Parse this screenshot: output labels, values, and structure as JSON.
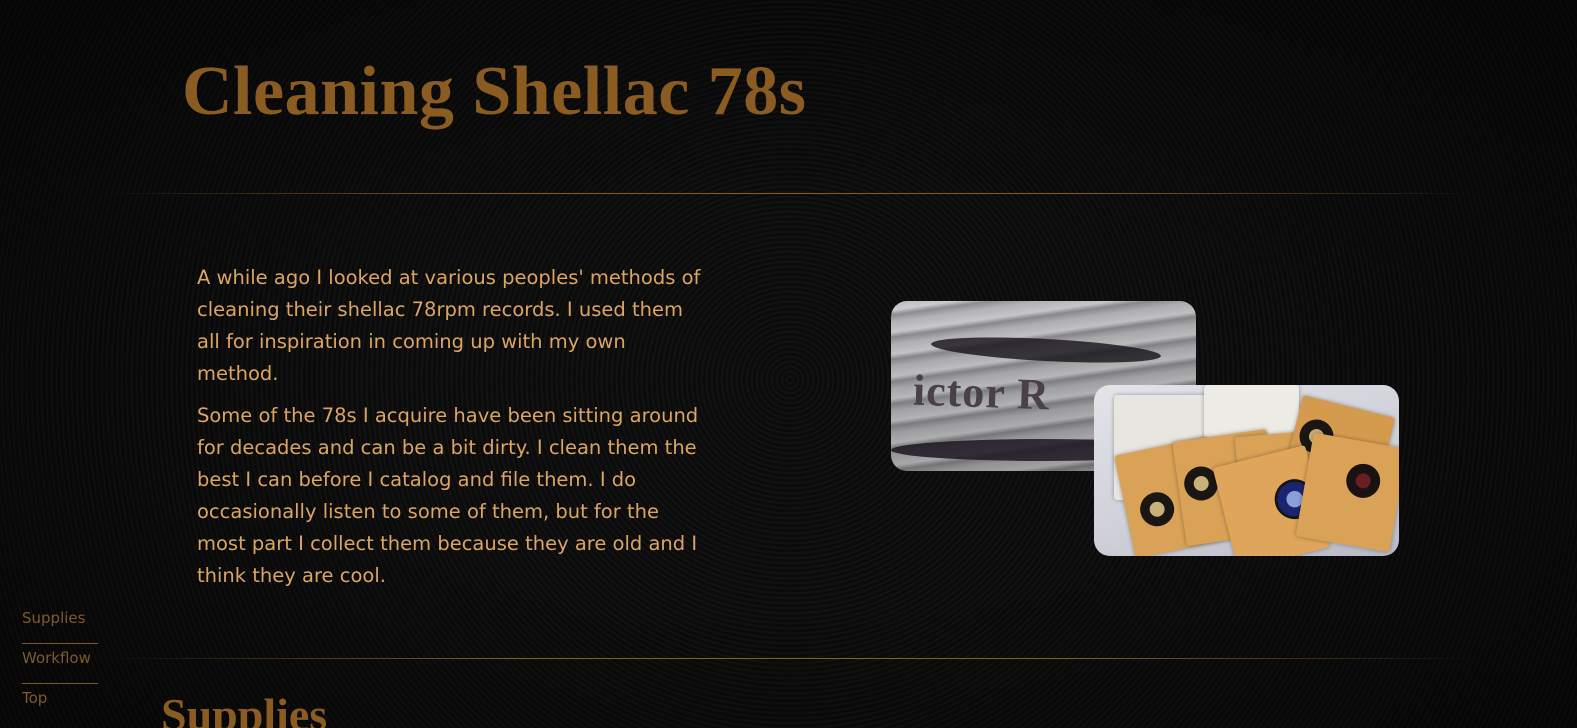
{
  "page": {
    "title": "Cleaning Shellac 78s",
    "accent_color": "#8a5c22",
    "text_color": "#dca564"
  },
  "intro": {
    "paragraphs": [
      "A while ago I looked at various peoples' methods of cleaning their shellac 78rpm records. I used them all for inspiration in coming up with my own method.",
      "Some of the 78s I acquire have been sitting around for decades and can be a bit dirty. I clean them the best I can before I catalog and file them. I do occasionally listen to some of them, but for the most part I collect them because they are old and I think they are cool."
    ]
  },
  "photos": {
    "first_label_text": "ictor R"
  },
  "side_nav": {
    "items": [
      "Supplies",
      "Workflow",
      "Top"
    ]
  },
  "sections": {
    "supplies_title": "Supplies"
  }
}
